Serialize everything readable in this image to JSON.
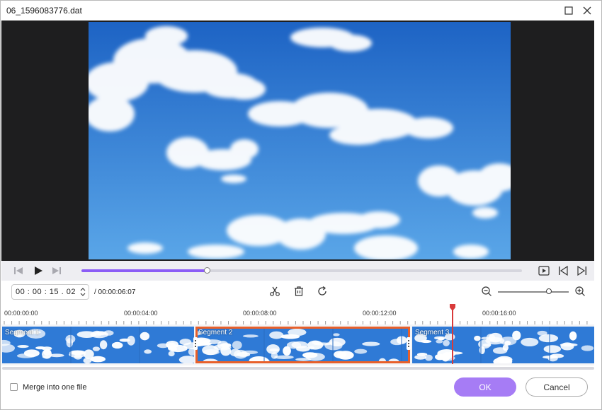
{
  "window": {
    "title": "06_1596083776.dat",
    "maximize_icon": "maximize-icon",
    "close_icon": "close-icon"
  },
  "preview": {
    "sky_top": "#1d63c4",
    "sky_bottom": "#5aa6e8"
  },
  "playback": {
    "prev_icon": "step-backward-icon",
    "play_icon": "play-icon",
    "next_icon": "step-forward-icon",
    "progress_fraction": 0.285,
    "right_icons": [
      "play-preview-icon",
      "mark-in-icon",
      "mark-out-icon"
    ]
  },
  "toolbar": {
    "current_time": "00 : 00 : 15 . 02",
    "total_time": "/ 00:00:06:07",
    "tool_icons": [
      "scissors-icon",
      "delete-icon",
      "reset-icon"
    ],
    "zoom_out_icon": "zoom-out-icon",
    "zoom_in_icon": "zoom-in-icon",
    "zoom_fraction": 0.72
  },
  "ruler": {
    "labels": [
      "00:00:00:00",
      "00:00:04:00",
      "00:00:08:00",
      "00:00:12:00",
      "00:00:16:00"
    ]
  },
  "timeline": {
    "segments": [
      {
        "label": "Segment 1",
        "selected": false
      },
      {
        "label": "Segment 2",
        "selected": true
      },
      {
        "label": "Segment 3",
        "selected": false
      }
    ],
    "selected_color": "#e8602a",
    "playhead_color": "#d93a3a"
  },
  "footer": {
    "merge_label": "Merge into one file",
    "merge_checked": false,
    "ok_label": "OK",
    "cancel_label": "Cancel",
    "accent": "#a67cf5"
  }
}
